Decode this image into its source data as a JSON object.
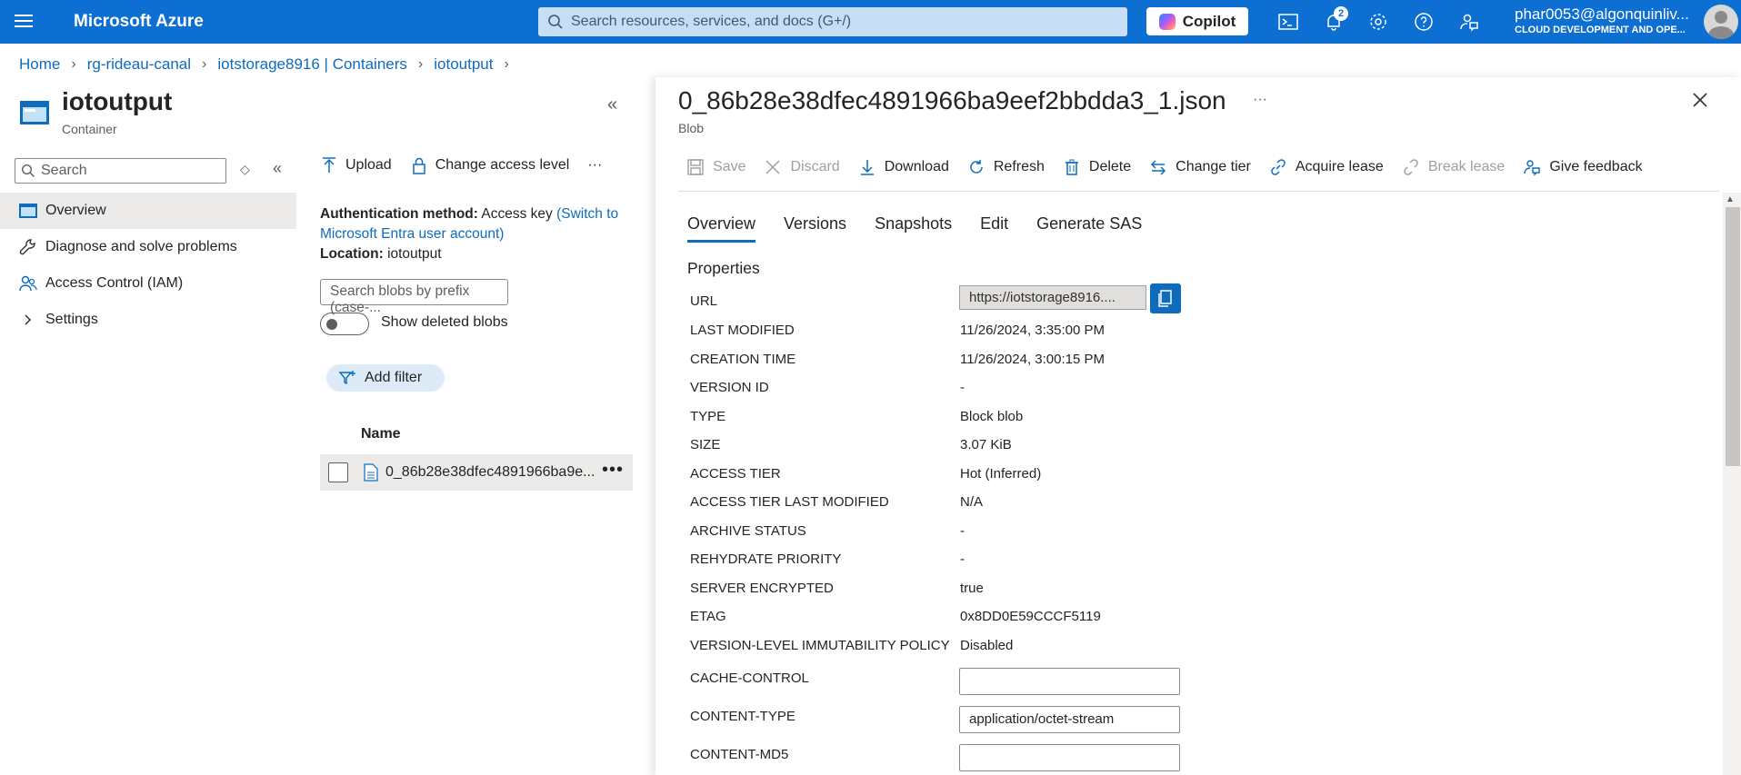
{
  "topbar": {
    "brand": "Microsoft Azure",
    "search_placeholder": "Search resources, services, and docs (G+/)",
    "copilot_label": "Copilot",
    "notification_count": "2",
    "user_name": "phar0053@algonquinliv...",
    "user_org": "CLOUD DEVELOPMENT AND OPE..."
  },
  "breadcrumb": {
    "items": [
      "Home",
      "rg-rideau-canal",
      "iotstorage8916 | Containers",
      "iotoutput"
    ]
  },
  "container": {
    "title": "iotoutput",
    "subtitle": "Container"
  },
  "nav": {
    "search_placeholder": "Search",
    "items": [
      {
        "label": "Overview",
        "icon": "container-icon"
      },
      {
        "label": "Diagnose and solve problems",
        "icon": "wrench-icon"
      },
      {
        "label": "Access Control (IAM)",
        "icon": "people-icon"
      },
      {
        "label": "Settings",
        "icon": "chevron-right-icon"
      }
    ]
  },
  "middle": {
    "toolbar": {
      "upload": "Upload",
      "change_access": "Change access level",
      "more": "···"
    },
    "auth_label": "Authentication method:",
    "auth_value": "Access key",
    "auth_link": "(Switch to Microsoft Entra user account)",
    "location_label": "Location:",
    "location_value": "iotoutput",
    "blob_search_placeholder": "Search blobs by prefix (case-...",
    "show_deleted_label": "Show deleted blobs",
    "add_filter_label": "Add filter",
    "column_name": "Name",
    "blobs": [
      {
        "name": "0_86b28e38dfec4891966ba9e..."
      }
    ]
  },
  "blob_panel": {
    "title": "0_86b28e38dfec4891966ba9eef2bbdda3_1.json",
    "subtitle": "Blob",
    "more": "···",
    "toolbar": {
      "save": "Save",
      "discard": "Discard",
      "download": "Download",
      "refresh": "Refresh",
      "delete": "Delete",
      "change_tier": "Change tier",
      "acquire_lease": "Acquire lease",
      "break_lease": "Break lease",
      "give_feedback": "Give feedback"
    },
    "tabs": [
      "Overview",
      "Versions",
      "Snapshots",
      "Edit",
      "Generate SAS"
    ],
    "active_tab": "Overview",
    "properties_heading": "Properties",
    "url_label": "URL",
    "url_value": "https://iotstorage8916....",
    "properties": [
      {
        "key": "LAST MODIFIED",
        "value": "11/26/2024, 3:35:00 PM"
      },
      {
        "key": "CREATION TIME",
        "value": "11/26/2024, 3:00:15 PM"
      },
      {
        "key": "VERSION ID",
        "value": "-"
      },
      {
        "key": "TYPE",
        "value": "Block blob"
      },
      {
        "key": "SIZE",
        "value": "3.07 KiB"
      },
      {
        "key": "ACCESS TIER",
        "value": "Hot (Inferred)"
      },
      {
        "key": "ACCESS TIER LAST MODIFIED",
        "value": "N/A"
      },
      {
        "key": "ARCHIVE STATUS",
        "value": "-"
      },
      {
        "key": "REHYDRATE PRIORITY",
        "value": "-"
      },
      {
        "key": "SERVER ENCRYPTED",
        "value": "true"
      },
      {
        "key": "ETAG",
        "value": "0x8DD0E59CCCF5119"
      },
      {
        "key": "VERSION-LEVEL IMMUTABILITY POLICY",
        "value": "Disabled"
      }
    ],
    "editable": [
      {
        "key": "CACHE-CONTROL",
        "value": ""
      },
      {
        "key": "CONTENT-TYPE",
        "value": "application/octet-stream"
      },
      {
        "key": "CONTENT-MD5",
        "value": ""
      }
    ]
  },
  "colors": {
    "topbar": "#0c6fd1",
    "accent": "#0f6cbd",
    "nav_active": "#edebe9"
  }
}
